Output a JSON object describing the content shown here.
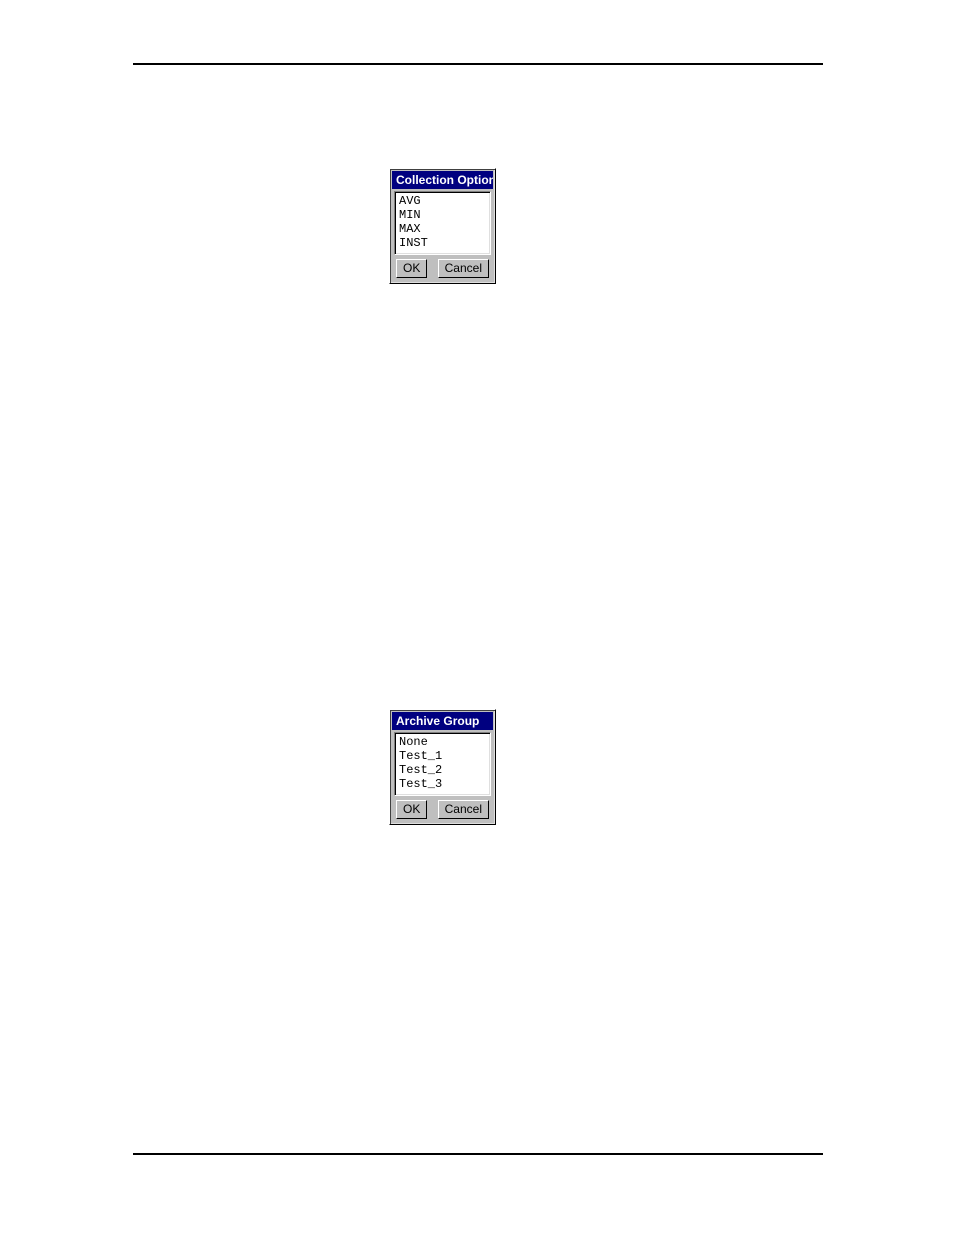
{
  "dialogs": {
    "collection": {
      "title": "Collection Option",
      "items": [
        "AVG",
        "MIN",
        "MAX",
        "INST"
      ],
      "ok_label": "OK",
      "cancel_label": "Cancel"
    },
    "archive": {
      "title": "Archive Group",
      "items": [
        "None",
        "Test_1",
        "Test_2",
        "Test_3"
      ],
      "ok_label": "OK",
      "cancel_label": "Cancel"
    }
  }
}
